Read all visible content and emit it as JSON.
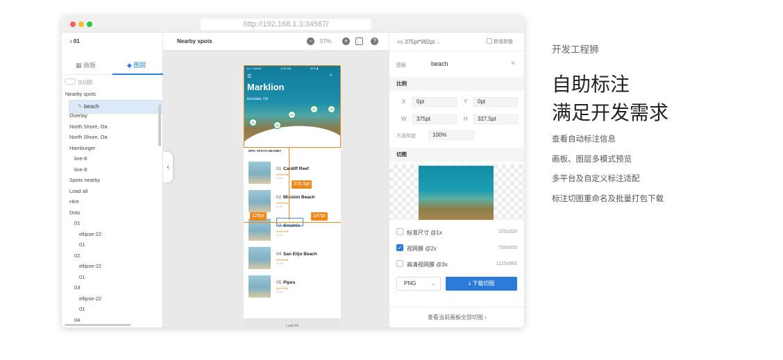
{
  "window": {
    "url": "http://192.168.1.3:34567/",
    "traffic_colors": [
      "#fe5f57",
      "#febc2e",
      "#28c840"
    ]
  },
  "left_panel": {
    "back_label": "01",
    "tabs": [
      {
        "label": "画板"
      },
      {
        "label": "图层",
        "active": true
      }
    ],
    "slice_only_label": "仅切图",
    "layers": [
      "Nearby spots",
      "beach",
      "Overlay",
      "North Shore, Oa",
      "North Shore, Oa",
      "Hamburger",
      "line-8",
      "line-8",
      "Spots nearby",
      "Load all",
      "Hire",
      "Dots",
      "01",
      "ellipse-22",
      "01",
      "02",
      "ellipse-22",
      "01",
      "03",
      "ellipse-22",
      "01",
      "04"
    ],
    "selected_layer": "beach"
  },
  "canvas": {
    "title": "Nearby spots",
    "zoom": "57%",
    "collapse_icon": "chevron-left",
    "app": {
      "status_carrier": "••••○ Carrier",
      "status_time": "9:41 AM",
      "status_battery": "42% ▮",
      "title": "Marklion",
      "location": "Encinitas, CA",
      "pins": [
        "05",
        "06",
        "02",
        "04",
        "03"
      ],
      "section": "EPIC SPOTS NEARBY",
      "spots": [
        {
          "num": "01",
          "name": "Cardiff Reef",
          "stars": "★★★★★",
          "dist": "0.1 m"
        },
        {
          "num": "02",
          "name": "Mission Beach",
          "stars": "★★★★★",
          "dist": "0.1 m"
        },
        {
          "num": "03",
          "name": "Swamis",
          "stars": "★★★★★",
          "dist": "0.1 m"
        },
        {
          "num": "04",
          "name": "San Elijo Beach",
          "stars": "★★★★★",
          "dist": "0.1 m"
        },
        {
          "num": "05",
          "name": "Pipes",
          "stars": "★★★★★",
          "dist": "0.1 m"
        }
      ],
      "load_all": "Load All"
    },
    "measures": {
      "height": "276.5pt",
      "left": "125pt",
      "right": "147pt"
    },
    "accent": "#f0891b"
  },
  "right_panel": {
    "artboard_size": "375pt*982pt",
    "value_copy_label": "数值取整",
    "layer_label": "图层",
    "layer_name": "beach",
    "scale_section": "比例",
    "x_label": "X",
    "x": "0pt",
    "y_label": "Y",
    "y": "0pt",
    "w_label": "W",
    "w": "375pt",
    "h_label": "H",
    "h": "327.5pt",
    "opacity_label": "不透明度",
    "opacity": "100%",
    "slice_section": "切图",
    "export_options": [
      {
        "label": "标准尺寸 @1x",
        "size": "375x328",
        "checked": false
      },
      {
        "label": "视网膜 @2x",
        "size": "750x655",
        "checked": true
      },
      {
        "label": "高清视网膜 @3x",
        "size": "1125x983",
        "checked": false
      }
    ],
    "format": "PNG",
    "download_label": "下载切图",
    "footer_link": "查看当前画板全部切图 ›",
    "accent": "#2b7bd8"
  },
  "marketing": {
    "brand": "开发工程狮",
    "headline1": "自助标注",
    "headline2": "满足开发需求",
    "features": [
      "查看自动标注信息",
      "画板、图层多模式预览",
      "多平台及自定义标注适配",
      "标注切图重命名及批量打包下载"
    ]
  }
}
